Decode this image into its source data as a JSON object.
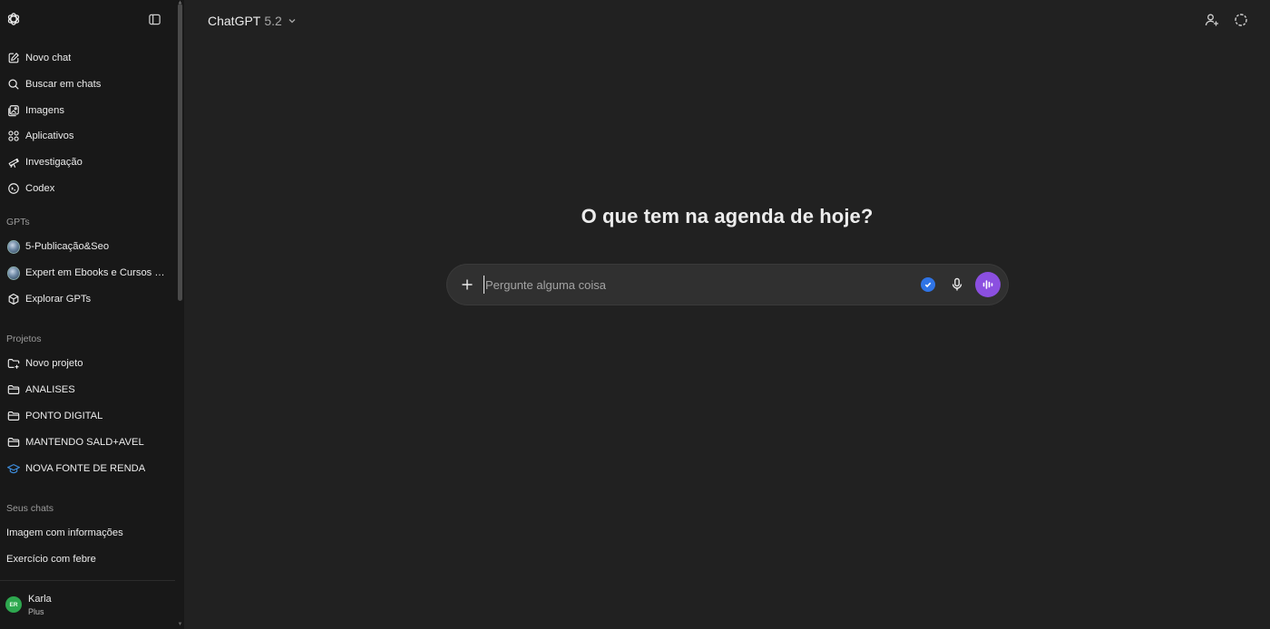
{
  "sidebar": {
    "nav": [
      {
        "label": "Novo chat",
        "icon": "edit-icon"
      },
      {
        "label": "Buscar em chats",
        "icon": "search-icon"
      },
      {
        "label": "Imagens",
        "icon": "images-icon"
      },
      {
        "label": "Aplicativos",
        "icon": "apps-grid-icon"
      },
      {
        "label": "Investigação",
        "icon": "telescope-icon"
      },
      {
        "label": "Codex",
        "icon": "codex-icon"
      }
    ],
    "gpts_title": "GPTs",
    "gpts": [
      {
        "label": "5-Publicação&Seo",
        "icon": "gpt-avatar"
      },
      {
        "label": "Expert em Ebooks e Cursos e...",
        "icon": "gpt-avatar"
      },
      {
        "label": "Explorar GPTs",
        "icon": "cube-icon"
      }
    ],
    "projects_title": "Projetos",
    "projects": [
      {
        "label": "Novo projeto",
        "icon": "folder-plus-icon"
      },
      {
        "label": "ANALISES",
        "icon": "folder-icon"
      },
      {
        "label": "PONTO DIGITAL",
        "icon": "folder-icon"
      },
      {
        "label": "MANTENDO SALD+AVEL",
        "icon": "folder-icon"
      },
      {
        "label": "NOVA FONTE DE RENDA",
        "icon": "graduation-cap-icon"
      }
    ],
    "chats_title": "Seus chats",
    "chats": [
      {
        "label": "Imagem com informações"
      },
      {
        "label": "Exercício com febre"
      }
    ],
    "user": {
      "initials": "ER",
      "name": "Karla",
      "plan": "Plus"
    }
  },
  "header": {
    "model_name": "ChatGPT",
    "model_version": "5.2"
  },
  "main": {
    "heading": "O que tem na agenda de hoje?",
    "composer": {
      "placeholder": "Pergunte alguma coisa",
      "value": ""
    }
  },
  "colors": {
    "sidebar_bg": "#181818",
    "main_bg": "#212121",
    "composer_bg": "#303030",
    "voice_button": "#8b4fe0",
    "check_badge": "#2f74e6",
    "avatar": "#2ea84f",
    "graduation_cap": "#3d8bd9"
  }
}
